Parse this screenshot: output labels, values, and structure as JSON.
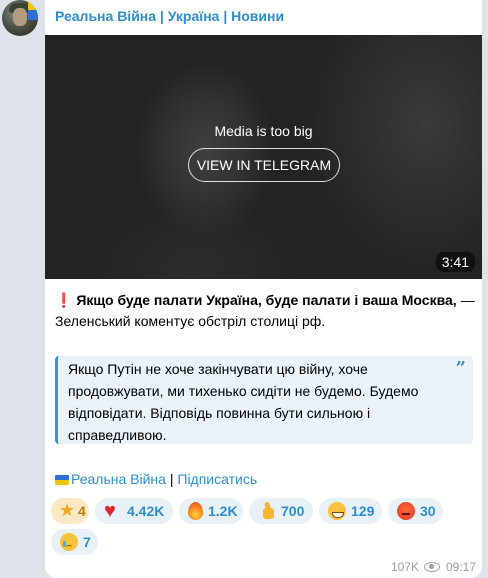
{
  "channel": {
    "title": "Реальна Війна | Україна | Новини"
  },
  "media": {
    "message": "Media is too big",
    "button_label": "VIEW IN TELEGRAM",
    "duration": "3:41"
  },
  "post": {
    "headline_mark": "❗",
    "headline_bold": "Якщо буде палати Україна, буде палати і ваша Москва,",
    "headline_rest": " — Зеленський коментує обстріл столиці рф.",
    "quote": "Якщо Путін не хоче закінчувати цю війну, хоче продовжувати, ми тихенько сидіти не будемо. Будемо відповідати. Відповідь повинна бути сильною і справедливою.",
    "channel_link": "Реальна Війна",
    "separator": " | ",
    "subscribe_link": "Підписатись"
  },
  "reactions": [
    {
      "icon": "star-icon",
      "count": "4"
    },
    {
      "icon": "red-heart-icon",
      "count": "4.42K"
    },
    {
      "icon": "fire-icon",
      "count": "1.2K"
    },
    {
      "icon": "thumbs-up-icon",
      "count": "700"
    },
    {
      "icon": "grinning-face-icon",
      "count": "129"
    },
    {
      "icon": "angry-face-icon",
      "count": "30"
    },
    {
      "icon": "crying-face-icon",
      "count": "7"
    }
  ],
  "meta": {
    "views": "107K",
    "time": "09:17"
  },
  "colors": {
    "accent": "#2e8ecb",
    "background": "#dde3e8",
    "quote_bar": "#3a92d1",
    "star_reaction": "#fce8c4"
  }
}
